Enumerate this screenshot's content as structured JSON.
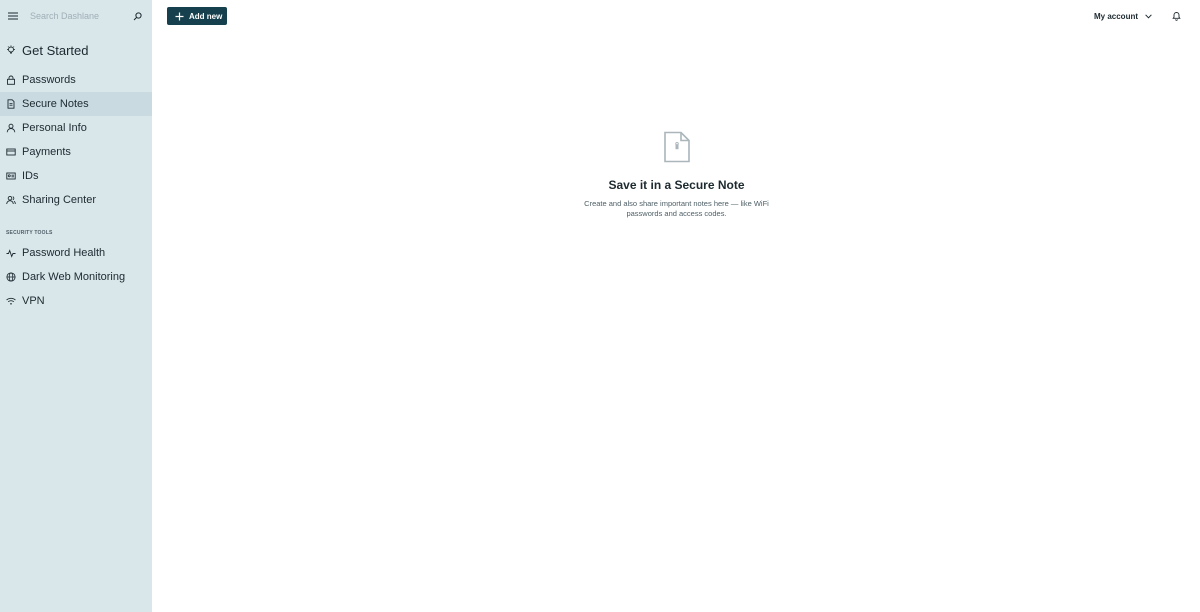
{
  "sidebar": {
    "search_placeholder": "Search Dashlane",
    "get_started": "Get Started",
    "items": [
      {
        "label": "Passwords",
        "icon": "lock-icon"
      },
      {
        "label": "Secure Notes",
        "icon": "note-icon",
        "active": true
      },
      {
        "label": "Personal Info",
        "icon": "person-icon"
      },
      {
        "label": "Payments",
        "icon": "card-icon"
      },
      {
        "label": "IDs",
        "icon": "id-card-icon"
      },
      {
        "label": "Sharing Center",
        "icon": "sharing-icon"
      }
    ],
    "security_section": "SECURITY TOOLS",
    "security_items": [
      {
        "label": "Password Health",
        "icon": "pulse-icon"
      },
      {
        "label": "Dark Web Monitoring",
        "icon": "globe-icon"
      },
      {
        "label": "VPN",
        "icon": "wifi-icon"
      }
    ]
  },
  "toolbar": {
    "add_new_label": "Add new",
    "account_label": "My account"
  },
  "empty_state": {
    "title": "Save it in a Secure Note",
    "description": "Create and also share important notes here — like WiFi passwords and access codes."
  },
  "colors": {
    "sidebar_bg": "#d9e6ea",
    "active_item_bg": "#c9dbe1",
    "primary_button": "#16404d"
  }
}
